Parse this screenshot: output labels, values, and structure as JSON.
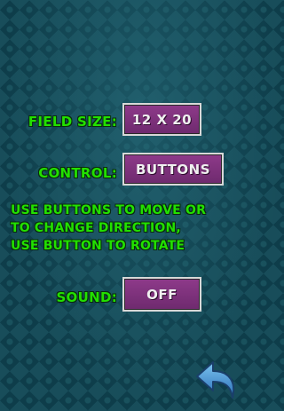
{
  "settings": {
    "field_size": {
      "label": "FIELD SIZE:",
      "value": "12 X 20"
    },
    "control": {
      "label": "CONTROL:",
      "value": "BUTTONS"
    },
    "control_help": [
      "USE BUTTONS TO MOVE OR",
      "TO CHANGE DIRECTION,",
      "USE BUTTON TO ROTATE"
    ],
    "sound": {
      "label": "SOUND:",
      "value": "OFF"
    }
  },
  "navigation": {
    "back_icon": "back-arrow-icon"
  },
  "colors": {
    "label_text": "#22e000",
    "button_fill": "#7a307a",
    "button_border": "#d8d8d8",
    "background": "#0e3d4a",
    "back_arrow": "#3a8fd6"
  }
}
